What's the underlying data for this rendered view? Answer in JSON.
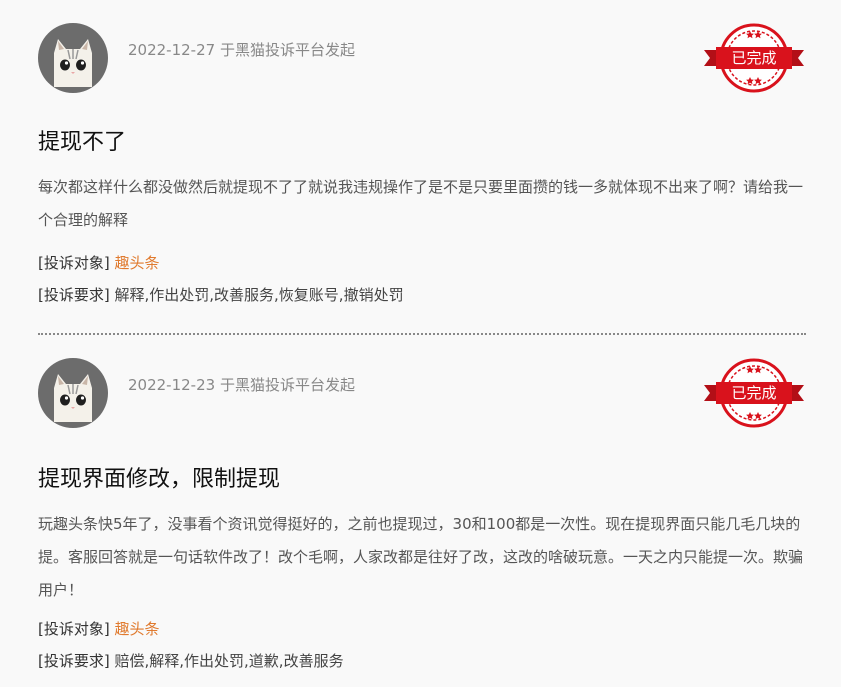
{
  "complaints": [
    {
      "date": "2022-12-27",
      "source": "于黑猫投诉平台发起",
      "stamp": "已完成",
      "title": "提现不了",
      "content": "每次都这样什么都没做然后就提现不了了就说我违规操作了是不是只要里面攒的钱一多就体现不出来了啊？请给我一个合理的解释",
      "target_label": "[投诉对象]",
      "target": "趣头条",
      "demand_label": "[投诉要求]",
      "demand": "解释,作出处罚,改善服务,恢复账号,撤销处罚"
    },
    {
      "date": "2022-12-23",
      "source": "于黑猫投诉平台发起",
      "stamp": "已完成",
      "title": "提现界面修改，限制提现",
      "content": "玩趣头条快5年了，没事看个资讯觉得挺好的，之前也提现过，30和100都是一次性。现在提现界面只能几毛几块的提。客服回答就是一句话软件改了！改个毛啊，人家改都是往好了改，这改的啥破玩意。一天之内只能提一次。欺骗用户！",
      "target_label": "[投诉对象]",
      "target": "趣头条",
      "demand_label": "[投诉要求]",
      "demand": "赔偿,解释,作出处罚,道歉,改善服务"
    }
  ],
  "colors": {
    "accent": "#e07a2e",
    "stamp_red": "#d9121c",
    "background": "#f9f9f9"
  },
  "icons": [
    "cat-avatar-icon",
    "completed-stamp-icon"
  ]
}
